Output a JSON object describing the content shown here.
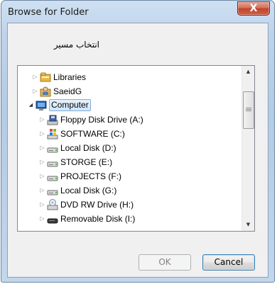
{
  "window": {
    "title": "Browse for Folder",
    "close_label": "X"
  },
  "instruction": "انتخاب مسیر",
  "tree": [
    {
      "label": "Libraries",
      "icon": "libraries-icon",
      "level": 1,
      "expander": "▷"
    },
    {
      "label": "SaeidG",
      "icon": "user-folder-icon",
      "level": 1,
      "expander": "▷"
    },
    {
      "label": "Computer",
      "icon": "computer-icon",
      "level": 0,
      "expander": "◢",
      "selected": true
    },
    {
      "label": "Floppy Disk Drive (A:)",
      "icon": "floppy-icon",
      "level": 2,
      "expander": "▷"
    },
    {
      "label": "SOFTWARE (C:)",
      "icon": "windows-drive-icon",
      "level": 2,
      "expander": "▷"
    },
    {
      "label": "Local Disk (D:)",
      "icon": "drive-icon",
      "level": 2,
      "expander": "▷"
    },
    {
      "label": "STORGE (E:)",
      "icon": "drive-icon",
      "level": 2,
      "expander": "▷"
    },
    {
      "label": "PROJECTS (F:)",
      "icon": "drive-icon",
      "level": 2,
      "expander": "▷"
    },
    {
      "label": "Local Disk (G:)",
      "icon": "drive-icon",
      "level": 2,
      "expander": "▷"
    },
    {
      "label": "DVD RW Drive (H:)",
      "icon": "dvd-icon",
      "level": 2,
      "expander": "▷"
    },
    {
      "label": "Removable Disk (I:)",
      "icon": "usb-drive-icon",
      "level": 2,
      "expander": "▷"
    }
  ],
  "buttons": {
    "ok": "OK",
    "cancel": "Cancel"
  },
  "colors": {
    "selection_border": "#84acdd",
    "frame": "#b4cbe6",
    "close": "#c1432b"
  }
}
